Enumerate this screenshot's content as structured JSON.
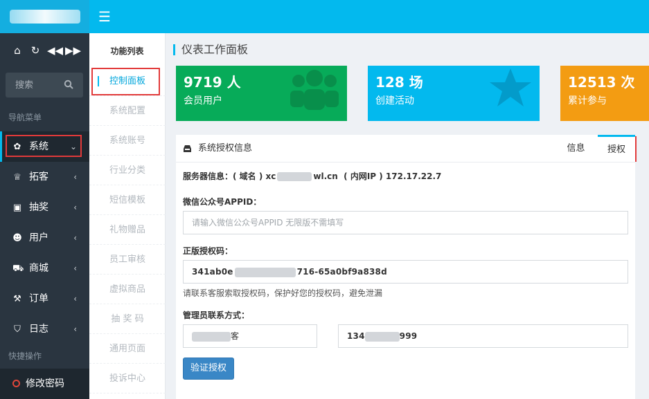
{
  "sidebar": {
    "search_placeholder": "搜索",
    "nav_section": "导航菜单",
    "items": [
      {
        "label": "系统",
        "icon": "gear-icon"
      },
      {
        "label": "拓客",
        "icon": "trophy-icon"
      },
      {
        "label": "抽奖",
        "icon": "gift-icon"
      },
      {
        "label": "用户",
        "icon": "users-icon"
      },
      {
        "label": "商城",
        "icon": "cart-icon"
      },
      {
        "label": "订单",
        "icon": "gavel-icon"
      },
      {
        "label": "日志",
        "icon": "shield-icon"
      }
    ],
    "quick_section": "快捷操作",
    "change_password": "修改密码"
  },
  "funclist": {
    "title": "功能列表",
    "items": [
      "控制面板",
      "系统配置",
      "系统账号",
      "行业分类",
      "短信模板",
      "礼物赠品",
      "员工审核",
      "虚拟商品",
      "抽 奖 码",
      "通用页面",
      "投诉中心"
    ]
  },
  "page": {
    "title": "仪表工作面板"
  },
  "stats": [
    {
      "value": "9719 人",
      "label": "会员用户",
      "color": "#07ab59",
      "icon": "users-icon"
    },
    {
      "value": "128 场",
      "label": "创建活动",
      "color": "#03b9ee",
      "icon": "star-icon"
    },
    {
      "value": "12513 次",
      "label": "累计参与",
      "color": "#f39c12",
      "icon": "chart-icon"
    }
  ],
  "panel": {
    "title": "系统授权信息",
    "tabs": [
      "信息",
      "授权"
    ],
    "server_info_label": "服务器信息：",
    "server_info_domain_prefix": "( 域名 ) xc",
    "server_info_domain_suffix": "wl.cn",
    "server_info_ip": "( 内网IP ) 172.17.22.7",
    "appid_label": "微信公众号APPID：",
    "appid_placeholder": "请输入微信公众号APPID 无限版不需填写",
    "license_label": "正版授权码：",
    "license_prefix": "341ab0e",
    "license_suffix": "716-65a0bf9a838d",
    "license_help": "请联系客服索取授权码，保护好您的授权码，避免泄漏",
    "admin_label": "管理员联系方式：",
    "admin_name_suffix": "客",
    "admin_phone_prefix": "134",
    "admin_phone_suffix": "999",
    "verify_button": "验证授权"
  }
}
